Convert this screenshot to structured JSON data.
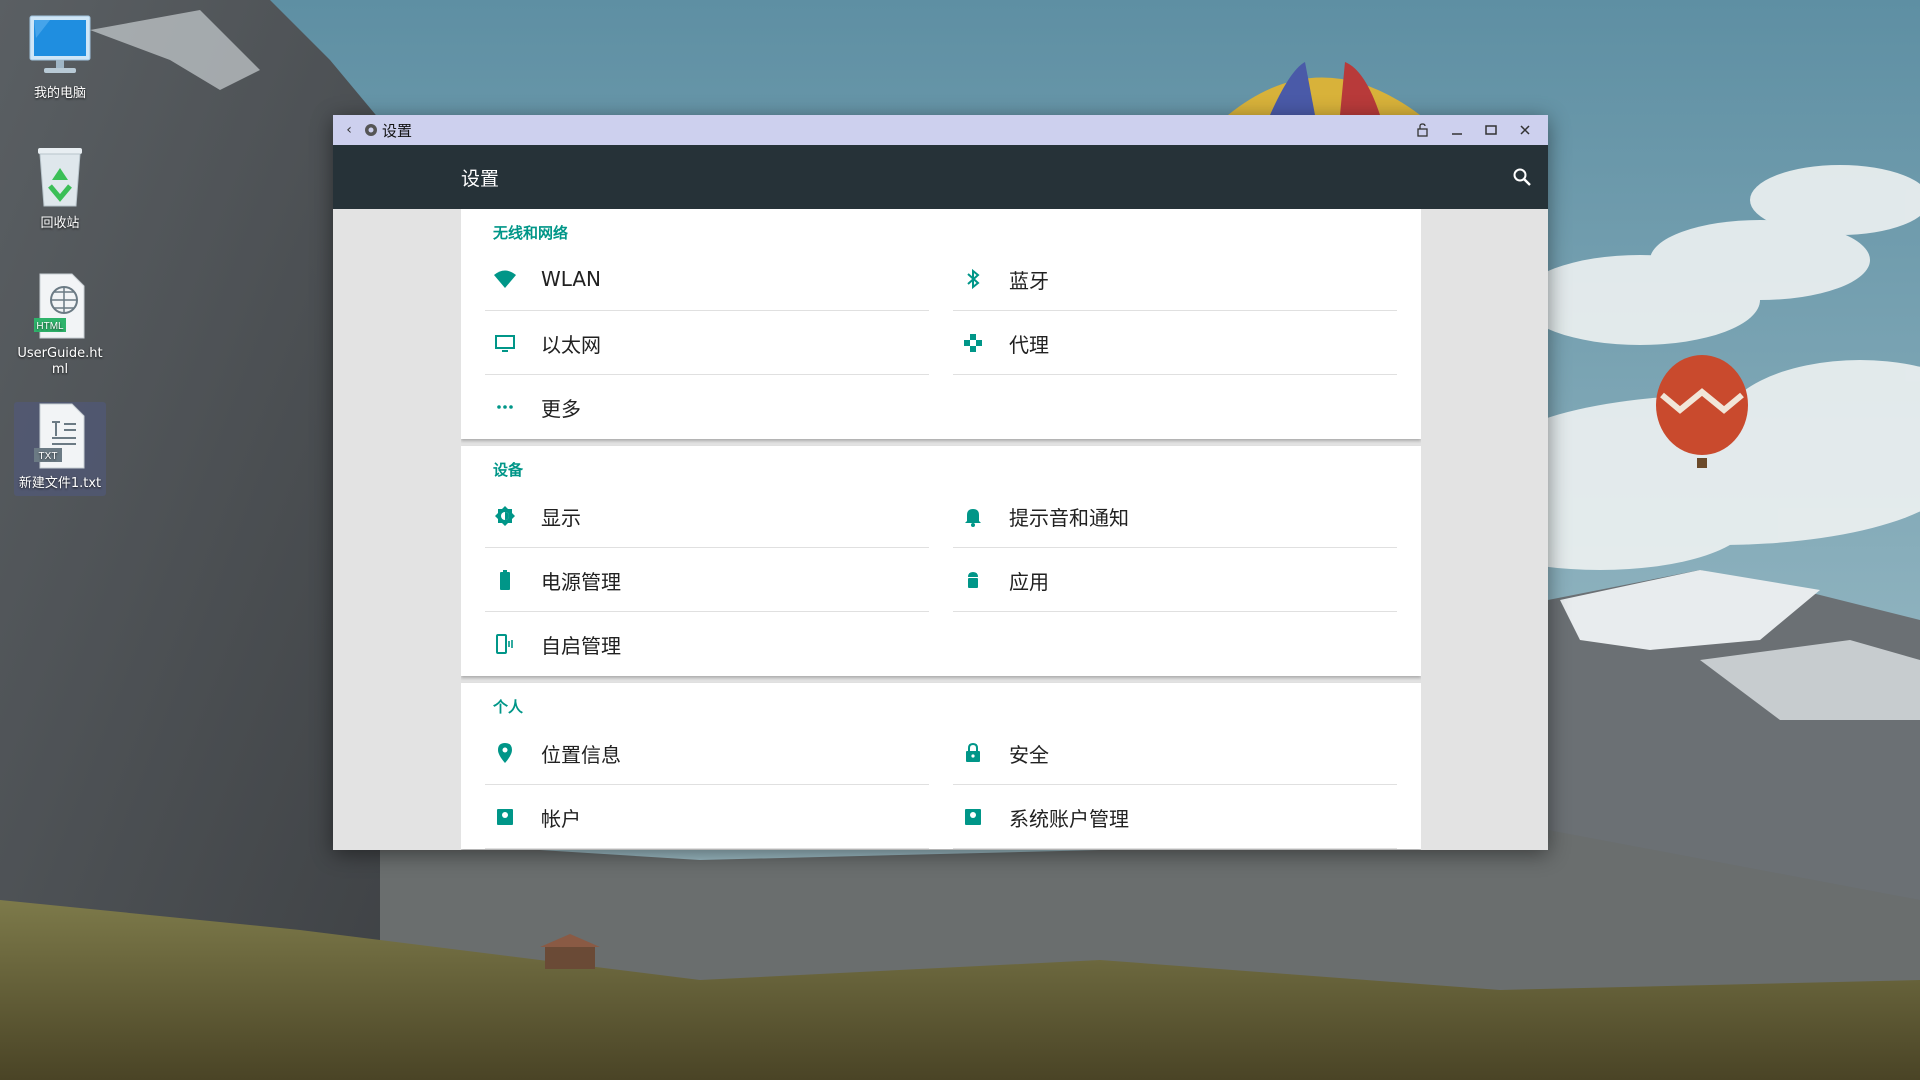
{
  "desktop": {
    "icons": [
      {
        "label": "我的电脑"
      },
      {
        "label": "回收站"
      },
      {
        "label": "UserGuide.html",
        "badge": "HTML"
      },
      {
        "label": "新建文件1.txt",
        "badge": "TXT"
      }
    ]
  },
  "window": {
    "title": "设置",
    "appbar_title": "设置",
    "accent": "#009688",
    "sections": [
      {
        "header": "无线和网络",
        "items": [
          {
            "label": "WLAN",
            "icon": "wifi-icon"
          },
          {
            "label": "蓝牙",
            "icon": "bluetooth-icon"
          },
          {
            "label": "以太网",
            "icon": "monitor-icon"
          },
          {
            "label": "代理",
            "icon": "proxy-icon"
          },
          {
            "label": "更多",
            "icon": "more-icon"
          }
        ]
      },
      {
        "header": "设备",
        "items": [
          {
            "label": "显示",
            "icon": "brightness-icon"
          },
          {
            "label": "提示音和通知",
            "icon": "bell-icon"
          },
          {
            "label": "电源管理",
            "icon": "battery-icon"
          },
          {
            "label": "应用",
            "icon": "android-icon"
          },
          {
            "label": "自启管理",
            "icon": "phone-vibrate-icon"
          }
        ]
      },
      {
        "header": "个人",
        "items": [
          {
            "label": "位置信息",
            "icon": "location-icon"
          },
          {
            "label": "安全",
            "icon": "lock-icon"
          },
          {
            "label": "帐户",
            "icon": "account-icon"
          },
          {
            "label": "系统账户管理",
            "icon": "account-icon"
          }
        ]
      }
    ]
  }
}
